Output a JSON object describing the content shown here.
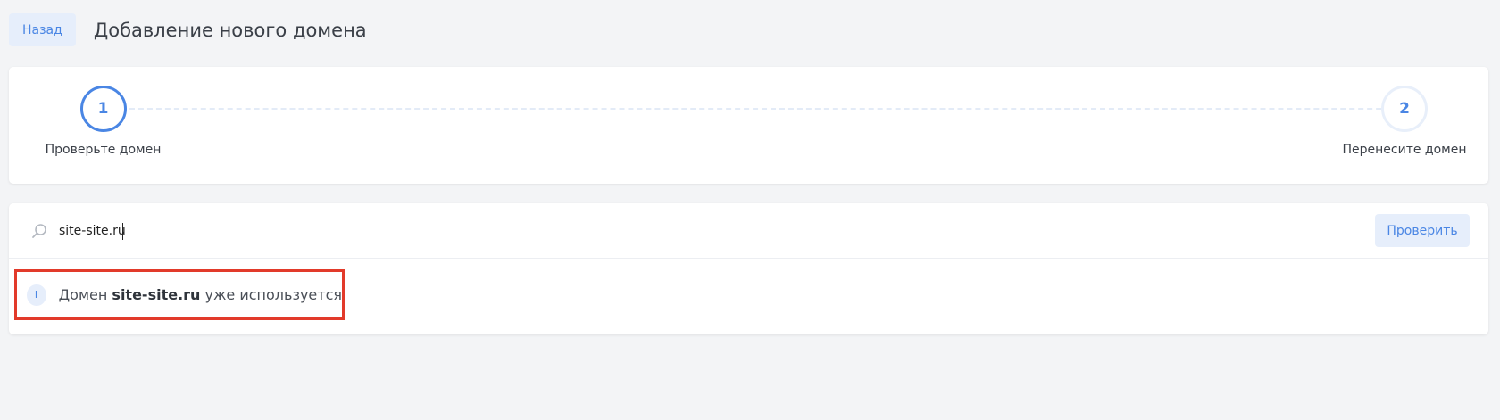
{
  "header": {
    "back_label": "Назад",
    "title": "Добавление нового домена"
  },
  "steps": [
    {
      "number": "1",
      "label": "Проверьте домен",
      "state": "active"
    },
    {
      "number": "2",
      "label": "Перенесите домен",
      "state": "inactive"
    }
  ],
  "search": {
    "icon": "search-icon",
    "value": "site-site.ru",
    "placeholder": "",
    "button_label": "Проверить"
  },
  "notice": {
    "icon": "info-icon",
    "icon_glyph": "i",
    "prefix": "Домен ",
    "domain": "site-site.ru",
    "suffix": " уже используется"
  },
  "colors": {
    "accent": "#4a86e4",
    "accent_bg": "#e6eefb",
    "page_bg": "#f3f4f6",
    "highlight_border": "#e23a2a"
  }
}
